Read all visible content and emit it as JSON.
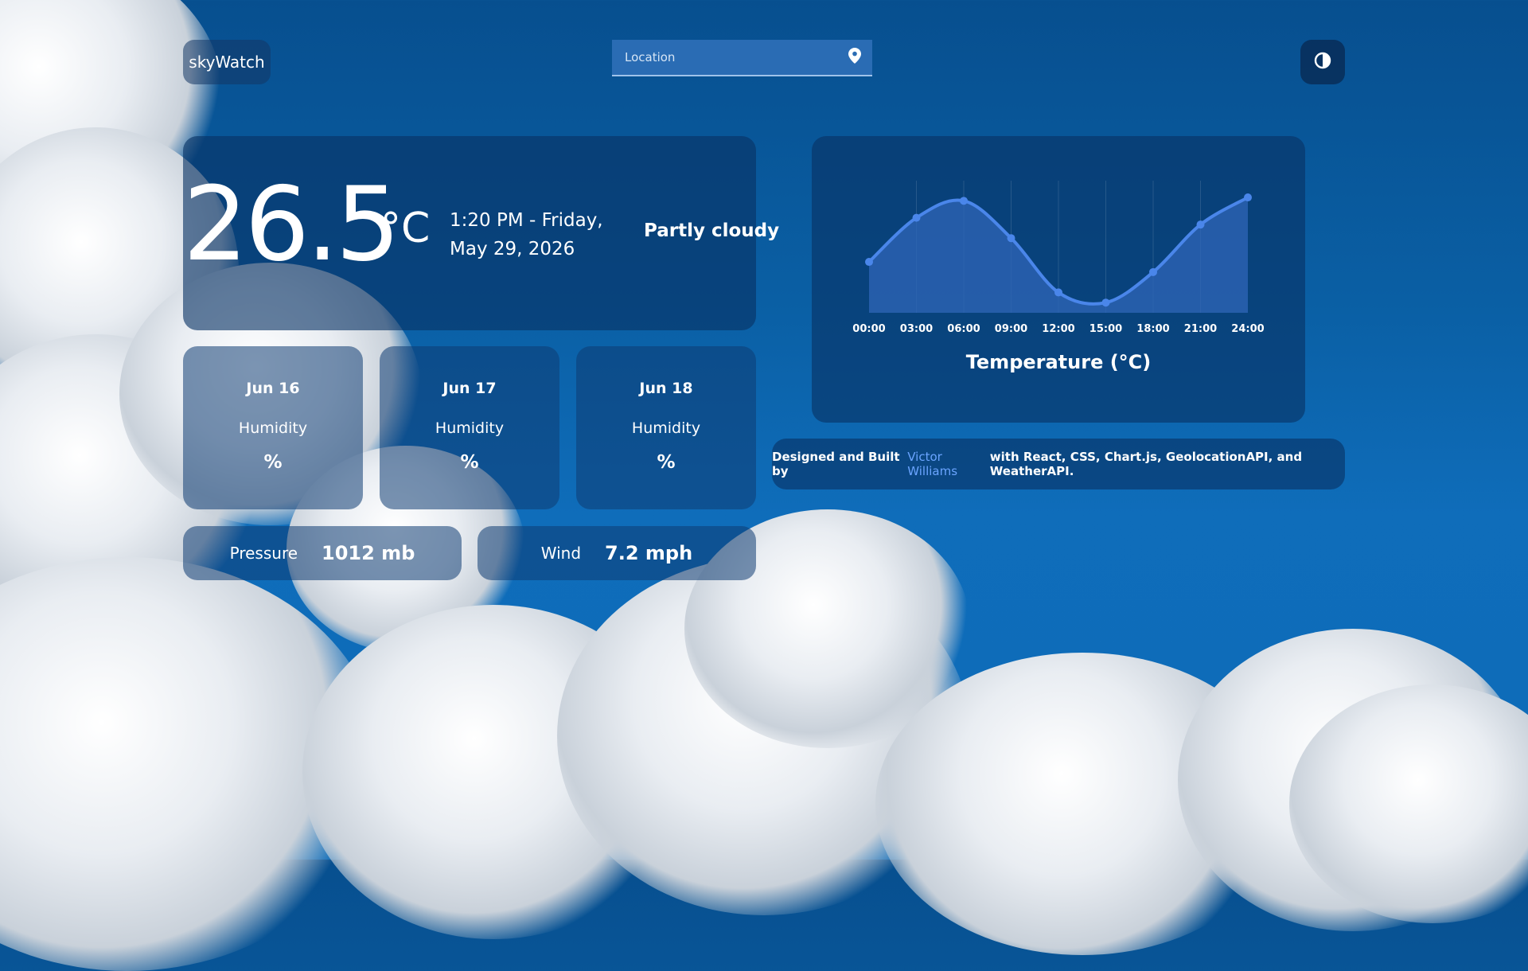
{
  "app": {
    "logo_text": "skyWatch"
  },
  "search": {
    "placeholder": "Location",
    "value": ""
  },
  "current": {
    "temperature": "26.5",
    "unit": "°C",
    "datetime": "1:20 PM - Friday, May 29, 2026",
    "condition": "Partly cloudy"
  },
  "forecast": [
    {
      "date": "Jun 16",
      "humidity_label": "Humidity",
      "humidity_value": "%"
    },
    {
      "date": "Jun 17",
      "humidity_label": "Humidity",
      "humidity_value": "%"
    },
    {
      "date": "Jun 18",
      "humidity_label": "Humidity",
      "humidity_value": "%"
    }
  ],
  "stats": {
    "pressure": {
      "label": "Pressure",
      "value": "1012 mb"
    },
    "wind": {
      "label": "Wind",
      "value": "7.2 mph"
    }
  },
  "credits": {
    "prefix": "Designed and Built by",
    "author": "Victor Williams",
    "suffix": "with React, CSS, Chart.js, GeolocationAPI, and WeatherAPI."
  },
  "icons": {
    "location": "location-pin-icon",
    "theme": "contrast-icon"
  },
  "colors": {
    "line": "#4a86ea",
    "fill": "#2f66b8"
  },
  "chart_data": {
    "type": "line",
    "title": "Temperature (°C)",
    "x": [
      "00:00",
      "03:00",
      "06:00",
      "09:00",
      "12:00",
      "15:00",
      "18:00",
      "21:00",
      "24:00"
    ],
    "values": [
      24.5,
      25.8,
      26.3,
      25.2,
      23.6,
      23.3,
      24.2,
      25.6,
      26.4
    ],
    "ylim": [
      23.0,
      26.8
    ],
    "grid": true
  }
}
